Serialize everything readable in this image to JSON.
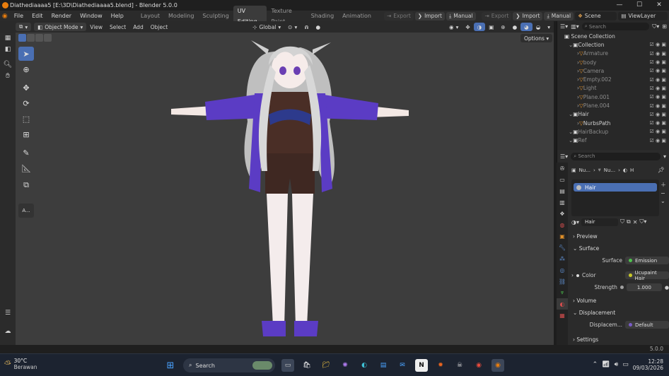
{
  "window": {
    "title": "Diathediaaaa5 [E:\\3D\\Diathediaaaa5.blend] - Blender 5.0.0",
    "controls": [
      "—",
      "☐",
      "✕"
    ]
  },
  "menu": [
    "File",
    "Edit",
    "Render",
    "Window",
    "Help"
  ],
  "workspaces": [
    "Layout",
    "Modeling",
    "Sculpting",
    "UV Editing",
    "Texture Paint",
    "Shading",
    "Animation"
  ],
  "active_workspace": "UV Editing",
  "header_tools": {
    "export_1": "Export",
    "import_1": "Import",
    "manual_1": "Manual",
    "export_2": "Export",
    "import_2": "Import",
    "manual_2": "Manual",
    "scene": "Scene",
    "view_layer": "ViewLayer"
  },
  "viewport_header": {
    "mode": "Object Mode",
    "menus": [
      "View",
      "Select",
      "Add",
      "Object"
    ],
    "transform": "Global",
    "options": "Options"
  },
  "outliner": {
    "search_placeholder": "Search",
    "scene_collection": "Scene Collection",
    "rows": [
      {
        "name": "Collection",
        "level": 1,
        "dim": false
      },
      {
        "name": "Armature",
        "level": 2,
        "dim": true
      },
      {
        "name": "body",
        "level": 2,
        "dim": true
      },
      {
        "name": "Camera",
        "level": 2,
        "dim": true
      },
      {
        "name": "Empty.002",
        "level": 2,
        "dim": true
      },
      {
        "name": "Light",
        "level": 2,
        "dim": true
      },
      {
        "name": "Plane.001",
        "level": 2,
        "dim": true
      },
      {
        "name": "Plane.004",
        "level": 2,
        "dim": true
      },
      {
        "name": "Hair",
        "level": 1,
        "dim": false
      },
      {
        "name": "NurbsPath",
        "level": 2,
        "dim": false
      },
      {
        "name": "HairBackup",
        "level": 1,
        "dim": true
      },
      {
        "name": "Ref",
        "level": 1,
        "dim": true
      }
    ]
  },
  "properties": {
    "search_placeholder": "Search",
    "breadcrumb": [
      "Nu...",
      "Nu...",
      "H"
    ],
    "material_slot": "Hair",
    "material_name": "Hair",
    "sections": {
      "preview": "Preview",
      "surface": "Surface",
      "volume": "Volume",
      "displacement": "Displacement",
      "settings": "Settings"
    },
    "surface_label": "Surface",
    "surface_value": "Emission",
    "color_label": "Color",
    "color_value": "Ucupaint Hair",
    "strength_label": "Strength",
    "strength_value": "1.000",
    "displacement_label": "Displacem...",
    "displacement_value": "Default"
  },
  "status": {
    "version": "5.0.0"
  },
  "taskbar": {
    "weather_temp": "30°C",
    "weather_desc": "Berawan",
    "search": "Search",
    "time": "12:28",
    "date": "09/03/2026"
  },
  "colors": {
    "accent": "#4a6fb3",
    "viewport": "#3d3d3d",
    "outfit_purple": "#5b3cc4",
    "outfit_brown": "#4a2e26"
  }
}
